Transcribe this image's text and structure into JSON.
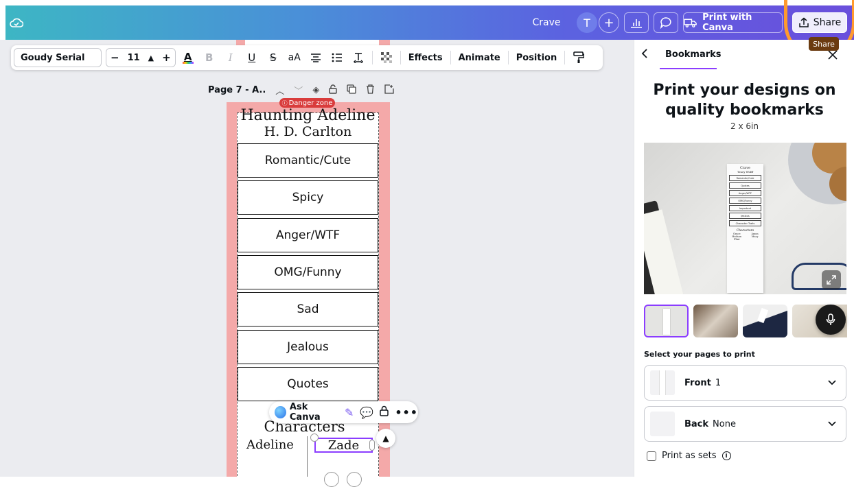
{
  "topbar": {
    "design_title": "Crave",
    "avatar_letter": "T",
    "print_with_canva_label": "Print with Canva",
    "share_label": "Share",
    "share_tooltip": "Share"
  },
  "toolbar": {
    "font_name": "Goudy Serial",
    "font_size": "11",
    "effects_label": "Effects",
    "animate_label": "Animate",
    "position_label": "Position"
  },
  "page_header": {
    "label": "Page 7 - A.."
  },
  "bookmark": {
    "danger_label": "Danger zone",
    "book_title": "Haunting Adeline",
    "author": "H. D. Carlton",
    "categories": [
      "Romantic/Cute",
      "Spicy",
      "Anger/WTF",
      "OMG/Funny",
      "Sad",
      "Jealous",
      "Quotes"
    ],
    "characters_heading": "Characters",
    "character_left": "Adeline",
    "character_right": "Zade"
  },
  "ask_canva": {
    "label": "Ask Canva"
  },
  "panel": {
    "back_icon": "chevron-left-icon",
    "breadcrumb": "Bookmarks",
    "heading": "Print your designs on quality bookmarks",
    "size": "2 x 6in",
    "preview": {
      "title": "Crave",
      "author": "Tracy Wolff",
      "items": [
        "Romantic/Cute",
        "Quotes",
        "Anger/WTF",
        "OMG/Funny",
        "Important",
        "Jealous",
        "Character Traits"
      ],
      "characters_heading": "Characters",
      "characters_left": "Grace\nHudson\nFlint",
      "characters_right": "Jaxon\nMacy"
    },
    "select_pages_label": "Select your pages to print",
    "front_label": "Front",
    "front_value": "1",
    "back_label": "Back",
    "back_value": "None",
    "print_as_sets_label": "Print as sets"
  },
  "colors": {
    "accent": "#8b3dff",
    "danger": "#d93c3c",
    "bleed": "#f4a9a9",
    "highlight_ring": "#ff9a2e"
  }
}
